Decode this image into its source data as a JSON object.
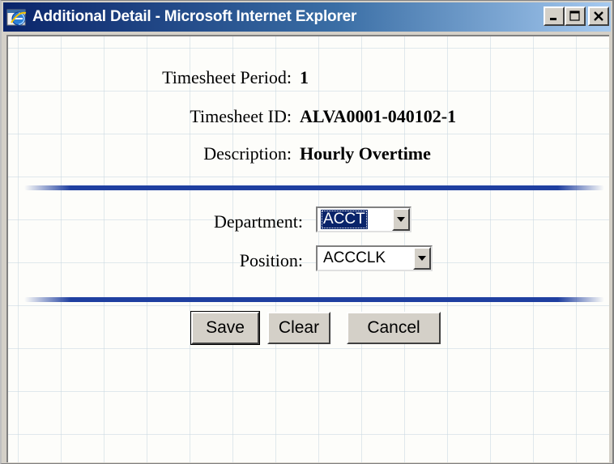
{
  "window": {
    "title": "Additional Detail - Microsoft Internet Explorer"
  },
  "details": {
    "period_label": "Timesheet Period:",
    "period_value": "1",
    "id_label": "Timesheet ID:",
    "id_value": "ALVA0001-040102-1",
    "description_label": "Description:",
    "description_value": "Hourly Overtime"
  },
  "form": {
    "department_label": "Department:",
    "department_value": "ACCT",
    "position_label": "Position:",
    "position_value": "ACCCLK"
  },
  "buttons": {
    "save_label": "Save",
    "clear_label": "Clear",
    "cancel_label": "Cancel"
  },
  "colors": {
    "titlebar": "#0a246a",
    "divider": "#1f3fa0",
    "selection": "#0a246a"
  }
}
